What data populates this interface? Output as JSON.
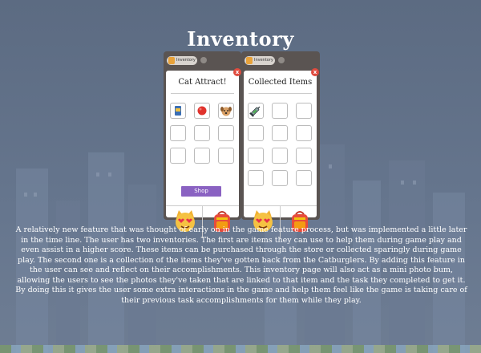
{
  "page": {
    "title": "Inventory",
    "description": "A relatively new feature that was thought of early on in the game feature process, but was implemented a little later in the time line.  The user has two inventories.  The first are items they can use to help them during game play and even assist in a higher score.  These items can be purchased through the store or collected sparingly during game play.  The second one is a collection of the items they've gotten back from the Catburglers.  By adding this feature in the user can see and reflect on their accomplishments.  This inventory page will also act as a mini photo bum, allowing the users to see the photos they've taken that are linked to that item and the task they completed to get it.  By doing this it gives the user some extra interactions in the game and help them feel like the game is taking care of their previous task accomplishments for them while they play."
  },
  "colors": {
    "background": "#5f6f86",
    "phone_frame": "#5a5452",
    "shop_button": "#8a62c2",
    "close_button": "#e04b3e"
  },
  "screens": [
    {
      "tab_active": "Inventory",
      "tab_inactive": "",
      "card_title": "Cat Attract!",
      "close_label": "x",
      "shop_label": "Shop",
      "items": [
        "cat-food-can-icon",
        "red-ball-icon",
        "dog-face-icon",
        "",
        "",
        "",
        "",
        "",
        ""
      ],
      "bottom_left_icon": "heart-eyes-cat-icon",
      "bottom_right_icon": "backpack-icon"
    },
    {
      "tab_active": "Inventory",
      "tab_inactive": "",
      "card_title": "Collected Items",
      "close_label": "x",
      "items": [
        "syringe-icon",
        "",
        "",
        "",
        "",
        "",
        "",
        "",
        "",
        "",
        "",
        ""
      ],
      "bottom_left_icon": "heart-eyes-cat-icon",
      "bottom_right_icon": "backpack-icon"
    }
  ]
}
